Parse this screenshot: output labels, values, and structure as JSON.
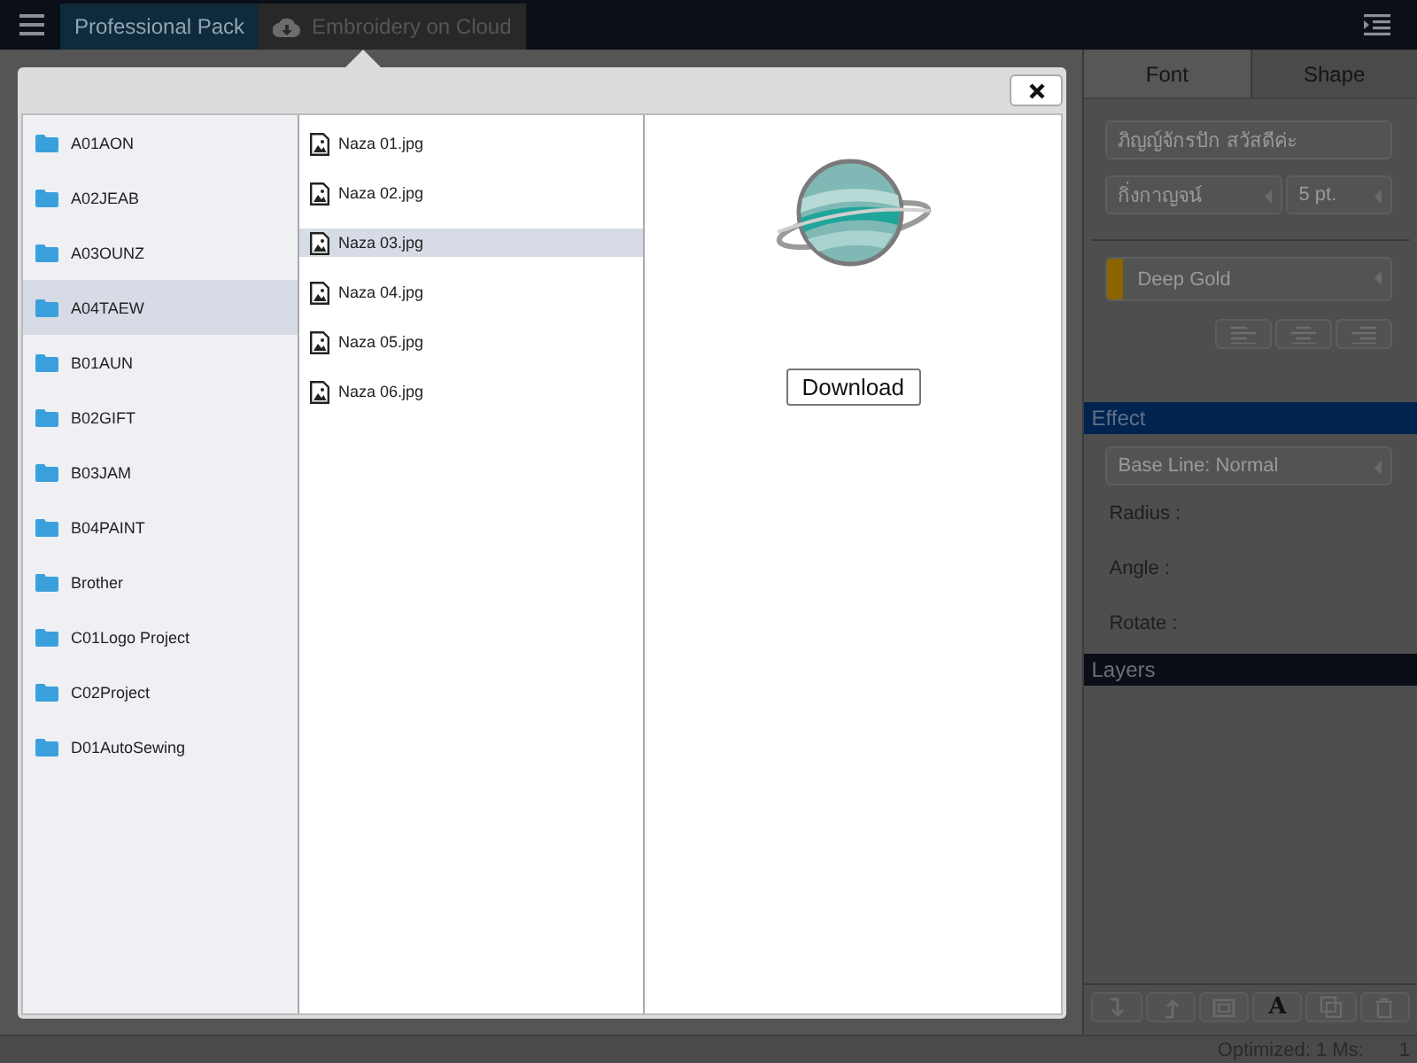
{
  "top_bar": {
    "tabs": [
      {
        "label": "Professional Pack",
        "selected": true,
        "kind": "plain"
      },
      {
        "label": "Embroidery on Cloud",
        "selected": false,
        "kind": "cloud"
      }
    ]
  },
  "dialog": {
    "folders": [
      {
        "label": "A01AON",
        "selected": false
      },
      {
        "label": "A02JEAB",
        "selected": false
      },
      {
        "label": "A03OUNZ",
        "selected": false
      },
      {
        "label": "A04TAEW",
        "selected": true
      },
      {
        "label": "B01AUN",
        "selected": false
      },
      {
        "label": "B02GIFT",
        "selected": false
      },
      {
        "label": "B03JAM",
        "selected": false
      },
      {
        "label": "B04PAINT",
        "selected": false
      },
      {
        "label": "Brother",
        "selected": false
      },
      {
        "label": "C01Logo Project",
        "selected": false
      },
      {
        "label": "C02Project",
        "selected": false
      },
      {
        "label": "D01AutoSewing",
        "selected": false
      }
    ],
    "files": [
      {
        "label": "Naza 01.jpg",
        "selected": false
      },
      {
        "label": "Naza 02.jpg",
        "selected": false
      },
      {
        "label": "Naza 03.jpg",
        "selected": true
      },
      {
        "label": "Naza 04.jpg",
        "selected": false
      },
      {
        "label": "Naza 05.jpg",
        "selected": false
      },
      {
        "label": "Naza 06.jpg",
        "selected": false
      }
    ],
    "download_button": "Download"
  },
  "side_panel": {
    "tabs": [
      {
        "label": "Font",
        "selected": true
      },
      {
        "label": "Shape",
        "selected": false
      }
    ],
    "text_field": {
      "value": "ภิญญ์จักรปัก สวัสดีค่ะ"
    },
    "font_select": "กิ่งกาญจน์",
    "size_select": "5 pt.",
    "color_select": {
      "label": "Deep Gold",
      "color": "#8a6500"
    },
    "effect": {
      "title": "Effect",
      "baseline_select": "Base Line: Normal",
      "labels": [
        "Radius :",
        "Angle :",
        "Rotate :"
      ]
    },
    "layers": {
      "title": "Layers"
    },
    "toolbar": [
      {
        "kind": "move-down",
        "disabled": true
      },
      {
        "kind": "move-up",
        "disabled": true
      },
      {
        "kind": "frame",
        "disabled": true
      },
      {
        "kind": "text",
        "label": "A",
        "disabled": false
      },
      {
        "kind": "copy",
        "disabled": true
      },
      {
        "kind": "delete",
        "disabled": true
      }
    ]
  },
  "status_bar": {
    "label": "Optimized: 1 Ms:",
    "value": "1"
  }
}
